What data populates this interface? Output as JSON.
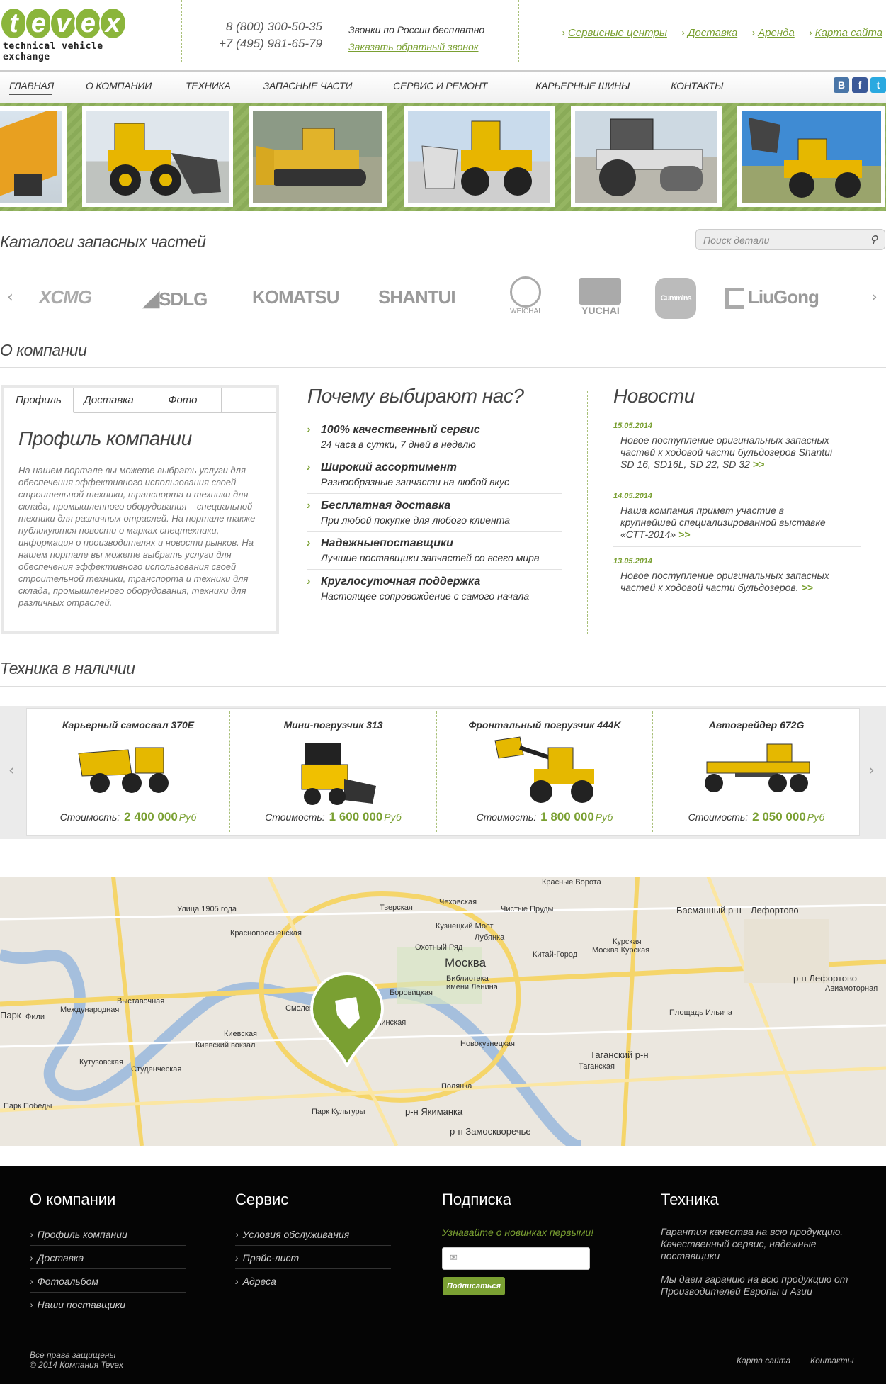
{
  "header": {
    "logo_letters": [
      "t",
      "e",
      "v",
      "e",
      "x"
    ],
    "logo_tagline": "technical vehicle exchange",
    "phone1": "8 (800) 300-50-35",
    "phone2": "+7 (495) 981-65-79",
    "free_calls": "Звонки по России бесплатно",
    "callback_link": "Заказать обратный звонок",
    "top_links": [
      "Сервисные центры",
      "Доставка",
      "Аренда",
      "Карта сайта"
    ]
  },
  "nav": {
    "items": [
      "Главная",
      "О компании",
      "Техника",
      "Запасные части",
      "Сервис и ремонт",
      "Карьерные шины",
      "Контакты"
    ]
  },
  "social": [
    {
      "icon": "vk-icon",
      "label": "В",
      "color": "#4a76a8"
    },
    {
      "icon": "facebook-icon",
      "label": "f",
      "color": "#3b5998"
    },
    {
      "icon": "twitter-icon",
      "label": "t",
      "color": "#2aa9e0"
    }
  ],
  "catalogs": {
    "title": "Каталоги запасных частей",
    "search_placeholder": "Поиск детали",
    "brands": [
      "XCMG",
      "SDLG",
      "KOMATSU",
      "SHANTUI",
      "WEICHAI",
      "YUCHAI",
      "Cummins",
      "LiuGong"
    ]
  },
  "about": {
    "title": "О компании",
    "tabs": [
      "Профиль",
      "Доставка",
      "Фото"
    ],
    "profile_title": "Профиль компании",
    "profile_text": "На нашем портале вы можете выбрать услуги для обеспечения эффективного использования своей строительной техники, транспорта и техники для склада, промышленного оборудования – специальной техники для различных отраслей. На портале также публикуются новости о марках спецтехники, информация о производителях и новости рынков. На нашем портале вы можете выбрать услуги для обеспечения эффективного использования своей строительной техники, транспорта и техники для склада, промышленного оборудования, техники для различных отраслей."
  },
  "why": {
    "title": "Почему выбирают нас?",
    "items": [
      {
        "title": "100% качественный сервис",
        "sub": "24 часа в сутки, 7 дней в неделю"
      },
      {
        "title": "Широкий ассортимент",
        "sub": "Разнообразные запчасти на любой вкус"
      },
      {
        "title": "Бесплатная доставка",
        "sub": "При любой покупке для любого клиента"
      },
      {
        "title": "Надежныепоставщики",
        "sub": "Лучшие поставщики запчастей со всего мира"
      },
      {
        "title": "Круглосуточная поддержка",
        "sub": "Настоящее сопровождение с самого начала"
      }
    ]
  },
  "news": {
    "title": "Новости",
    "more": ">>",
    "items": [
      {
        "date": "15.05.2014",
        "text": "Новое поступление оригинальных запасных частей к ходовой части бульдозеров Shantui SD 16, SD16L, SD 22, SD 32"
      },
      {
        "date": "14.05.2014",
        "text": "Наша компания примет участие в крупнейшей специализированной выставке «СТТ-2014»"
      },
      {
        "date": "13.05.2014",
        "text": "Новое поступление оригинальных запасных частей к ходовой части бульдозеров."
      }
    ]
  },
  "stock": {
    "title": "Техника в наличии",
    "price_label": "Стоимость:",
    "currency": "Руб",
    "items": [
      {
        "name": "Карьерный самосвал 370E",
        "price": "2 400 000"
      },
      {
        "name": "Мини-погрузчик 313",
        "price": "1 600 000"
      },
      {
        "name": "Фронтальный погрузчик 444K",
        "price": "1 800 000"
      },
      {
        "name": "Автогрейдер 672G",
        "price": "2 050 000"
      }
    ]
  },
  "map": {
    "labels": [
      "Красные Ворота",
      "Басманный р-н",
      "Лефортово",
      "Улица 1905 года",
      "Тверская",
      "Чеховская",
      "Чистые Пруды",
      "Кузнецкий Мост",
      "Лубянка",
      "Краснопресненская",
      "Охотный Ряд",
      "Китай-Город",
      "Курская",
      "Москва Курская",
      "Москва",
      "Библиотека имени Ленина",
      "Боровицкая",
      "р-н Лефортово",
      "Авиамоторная",
      "Выставочная",
      "Международная",
      "Смоленская",
      "Кропоткинская",
      "Площадь Ильича",
      "Фили",
      "Киевская",
      "Киевский вокзал",
      "Новокузнецкая",
      "Таганский р-н",
      "Таганская",
      "Кутузовская",
      "Студенческая",
      "Полянка",
      "Парк Победы",
      "Парк Культуры",
      "р-н Якиманка",
      "р-н Замоскворечье",
      "Парк"
    ]
  },
  "footer": {
    "about": {
      "title": "О компании",
      "links": [
        "Профиль компании",
        "Доставка",
        "Фотоальбом",
        "Наши поставщики"
      ]
    },
    "service": {
      "title": "Сервис",
      "links": [
        "Условия обслуживания",
        "Прайс-лист",
        "Адреса"
      ]
    },
    "subscribe": {
      "title": "Подписка",
      "text": "Узнавайте о новинках первыми!",
      "button": "Подписаться"
    },
    "tech": {
      "title": "Техника",
      "p1": "Гарантия качества на всю продукцию. Качественный сервис, надежные поставщики",
      "p2": "Мы даем гаранию на всю продукцию от Производителей Европы и Азии"
    },
    "copyright1": "Все права защищены",
    "copyright2": "© 2014 Компания Tevex",
    "bottom_links": [
      "Карта сайта",
      "Контакты"
    ]
  },
  "colors": {
    "accent": "#7aa032",
    "footer_bg": "#050505",
    "slider_bg": "#8aab58"
  }
}
